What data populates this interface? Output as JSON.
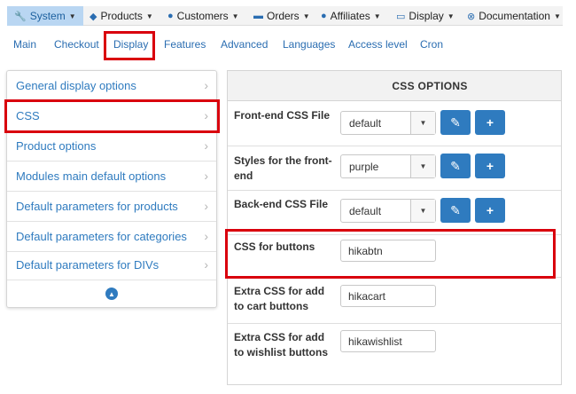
{
  "topmenu": [
    {
      "label": "System",
      "icon": "wrench-icon",
      "glyph": "🔧"
    },
    {
      "label": "Products",
      "icon": "cubes-icon",
      "glyph": "◆"
    },
    {
      "label": "Customers",
      "icon": "user-icon",
      "glyph": "●"
    },
    {
      "label": "Orders",
      "icon": "credit-card-icon",
      "glyph": "▬"
    },
    {
      "label": "Affiliates",
      "icon": "users-icon",
      "glyph": "●"
    },
    {
      "label": "Display",
      "icon": "monitor-icon",
      "glyph": "▭"
    },
    {
      "label": "Documentation",
      "icon": "life-ring-icon",
      "glyph": "⊗"
    }
  ],
  "tabs": [
    "Main",
    "Checkout",
    "Display",
    "Features",
    "Advanced",
    "Languages",
    "Access level",
    "Cron"
  ],
  "sidebar": {
    "items": [
      "General display options",
      "CSS",
      "Product options",
      "Modules main default options",
      "Default parameters for products",
      "Default parameters for categories",
      "Default parameters for DIVs"
    ],
    "chevron": "›",
    "collapse_glyph": "▲"
  },
  "css_options": {
    "title": "CSS OPTIONS",
    "rows": [
      {
        "label": "Front-end CSS File",
        "value": "default"
      },
      {
        "label": "Styles for the front-end",
        "value": "purple"
      },
      {
        "label": "Back-end CSS File",
        "value": "default"
      },
      {
        "label": "CSS for buttons",
        "value": "hikabtn"
      },
      {
        "label": "Extra CSS for add to cart buttons",
        "value": "hikacart"
      },
      {
        "label": "Extra CSS for add to wishlist buttons",
        "value": "hikawishlist"
      }
    ],
    "edit_glyph": "✎",
    "add_glyph": "+",
    "caret_glyph": "▼"
  },
  "colors": {
    "accent": "#2f7bbf",
    "highlight": "#d9000d",
    "active_menu": "#b9d6f2"
  }
}
